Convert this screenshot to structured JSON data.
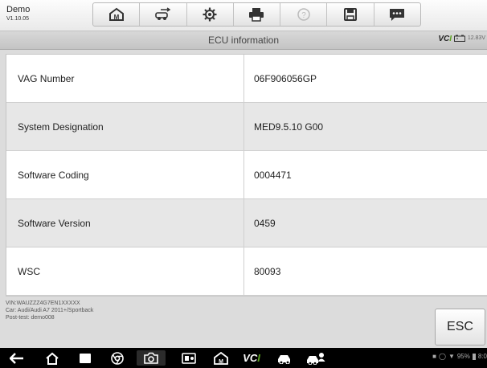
{
  "app": {
    "name": "Demo",
    "version": "V1.10.05"
  },
  "toolbar": {
    "tools": [
      {
        "icon": "home-icon"
      },
      {
        "icon": "vehicle-swap-icon"
      },
      {
        "icon": "settings-gear-icon"
      },
      {
        "icon": "printer-icon"
      },
      {
        "icon": "help-icon"
      },
      {
        "icon": "save-floppy-icon"
      },
      {
        "icon": "message-icon"
      }
    ]
  },
  "subheader": {
    "title": "ECU information",
    "vci_prefix": "VC",
    "vci_suffix": "I",
    "voltage": "12.83V"
  },
  "ecu_info": [
    {
      "label": "VAG Number",
      "value": "06F906056GP"
    },
    {
      "label": "System Designation",
      "value": "MED9.5.10   G00"
    },
    {
      "label": "Software Coding",
      "value": "0004471"
    },
    {
      "label": "Software Version",
      "value": "0459"
    },
    {
      "label": "WSC",
      "value": "80093"
    }
  ],
  "vehicle_info": {
    "vin": "VIN:WAUZZZ4G7EN1XXXXX",
    "car": "Car: Audi/Audi A7 2011+/Sportback",
    "post_test": "Post-test: demo008"
  },
  "esc_label": "ESC",
  "navbar": {
    "vci_prefix": "VC",
    "vci_suffix": "I"
  },
  "status_bar": {
    "battery": "95%",
    "time": "8:0"
  }
}
